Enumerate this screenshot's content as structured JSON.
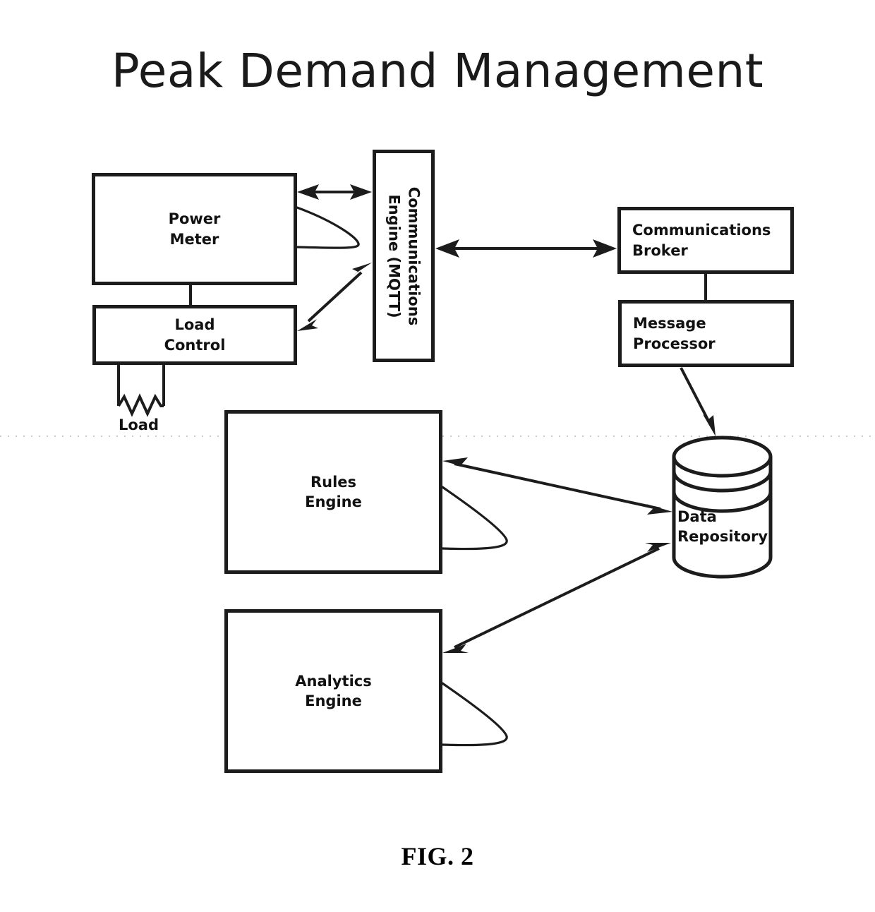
{
  "figure": {
    "title": "Peak Demand Management",
    "caption": "FIG. 2",
    "domain": "patent-block-diagram",
    "colors": {
      "ink": "#1c1c1c",
      "background": "#ffffff",
      "title_ink": "#1a1a1a",
      "scan_artifact": "#b9b9b9"
    }
  },
  "nodes": {
    "power_meter": {
      "label": "Power\nMeter",
      "shape": "rectangle"
    },
    "load_control": {
      "label": "Load\nControl",
      "shape": "rectangle"
    },
    "load": {
      "label": "Load",
      "shape": "resistor-symbol"
    },
    "comms_engine": {
      "label": "Communications\nEngine (MQTT)",
      "shape": "rectangle-vertical-text"
    },
    "comms_broker": {
      "label": "Communications\nBroker",
      "shape": "rectangle"
    },
    "message_processor": {
      "label": "Message\nProcessor",
      "shape": "rectangle"
    },
    "rules_engine": {
      "label": "Rules\nEngine",
      "shape": "rectangle"
    },
    "analytics_engine": {
      "label": "Analytics\nEngine",
      "shape": "rectangle"
    },
    "data_repository": {
      "label": "Data\nRepository",
      "shape": "cylinder"
    }
  },
  "edges": [
    {
      "id": "pm-ce",
      "from": "power_meter",
      "to": "comms_engine",
      "kind": "bidirectional"
    },
    {
      "id": "pm-self",
      "from": "power_meter",
      "to": "power_meter",
      "kind": "self-loop"
    },
    {
      "id": "lc-ce",
      "from": "load_control",
      "to": "comms_engine",
      "kind": "bidirectional"
    },
    {
      "id": "pm-lc",
      "from": "power_meter",
      "to": "load_control",
      "kind": "plain-link"
    },
    {
      "id": "lc-load",
      "from": "load_control",
      "to": "load",
      "kind": "plain-link"
    },
    {
      "id": "ce-cb",
      "from": "comms_engine",
      "to": "comms_broker",
      "kind": "bidirectional"
    },
    {
      "id": "cb-mp",
      "from": "comms_broker",
      "to": "message_processor",
      "kind": "plain-link"
    },
    {
      "id": "mp-dr",
      "from": "message_processor",
      "to": "data_repository",
      "kind": "directional"
    },
    {
      "id": "re-dr",
      "from": "rules_engine",
      "to": "data_repository",
      "kind": "bidirectional"
    },
    {
      "id": "re-self",
      "from": "rules_engine",
      "to": "rules_engine",
      "kind": "self-loop"
    },
    {
      "id": "ae-dr",
      "from": "analytics_engine",
      "to": "data_repository",
      "kind": "bidirectional"
    },
    {
      "id": "ae-self",
      "from": "analytics_engine",
      "to": "analytics_engine",
      "kind": "self-loop"
    }
  ]
}
